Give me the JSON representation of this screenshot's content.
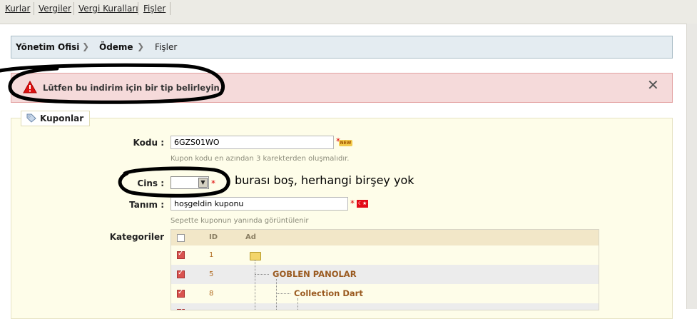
{
  "topnav": {
    "links": [
      "Kurlar",
      "Vergiler",
      "Vergi Kuralları",
      "Fişler"
    ]
  },
  "breadcrumb": {
    "items": [
      "Yönetim Ofisi",
      "Ödeme",
      "Fişler"
    ]
  },
  "alert": {
    "message": "Lütfen bu indirim için bir tip belirleyin.",
    "close": "✕"
  },
  "panel": {
    "title": "Kuponlar"
  },
  "form": {
    "code_label": "Kodu :",
    "code_value": "6GZS01WO",
    "code_hint": "Kupon kodu en azından 3 karekterden oluşmalıdır.",
    "new_badge": "NEW",
    "type_label": "Cins :",
    "type_value": "",
    "desc_label": "Tanım :",
    "desc_value": "hoşgeldin kuponu",
    "desc_hint": "Sepette kuponun yanında görüntülenir",
    "required": "*",
    "categories_label": "Kategoriler"
  },
  "grid": {
    "headers": [
      "ID",
      "Ad"
    ],
    "rows": [
      {
        "checked": true,
        "id": "1",
        "name": ""
      },
      {
        "checked": true,
        "id": "5",
        "name": "GOBLEN PANOLAR"
      },
      {
        "checked": true,
        "id": "8",
        "name": "Collection Dart"
      }
    ]
  },
  "annotation": {
    "text": "burası boş, herhangi birşey yok"
  },
  "colors": {
    "alert_bg": "#f5dada",
    "panel_bg": "#fefde9",
    "category_text": "#9a5a20"
  }
}
